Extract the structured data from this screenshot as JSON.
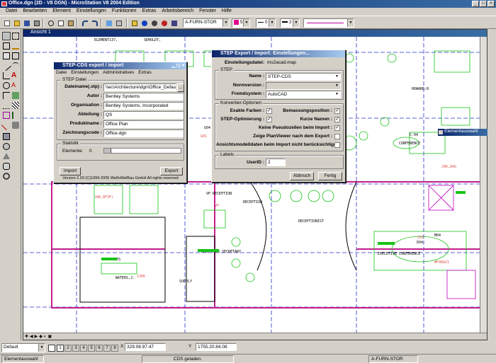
{
  "app": {
    "title": "Office.dgn (2D - V8 DGN) - MicroStation V8 2004 Edition",
    "menu": [
      "Datei",
      "Bearbeiten",
      "Element",
      "Einstellungen",
      "Funktionen",
      "Extras",
      "Arbeitsbereich",
      "Fenster",
      "Hilfe"
    ],
    "level_combo": "A-FURN-STOR",
    "color_value": "5",
    "style_value": "0",
    "weight_value": "2"
  },
  "view": {
    "title": "Ansicht 1"
  },
  "cad_labels": {
    "conference": "CONFERENCE",
    "reception": "RECEPTION",
    "receptionist": "RECEPTIONIST",
    "vp_reception": "VP RECEPTION",
    "waters": "WATERS,J.",
    "vice_pres_secretary": "VICE PRES SECRETARY",
    "executive_conference": "EXECUTIVE CONFERENCE",
    "vice_pres": "VICE PRES",
    "supply": "SUPPLY",
    "ceo": "C-04",
    "g04": "G04",
    "d04": "D04",
    "m04": "M04",
    "tag1": "ELEMENT137,",
    "tag2": "SEHOLDT,",
    "tag3": "HOWARD,R"
  },
  "step_export": {
    "title": "STEP-CDS export / import",
    "menu": [
      "Datei",
      "Einstellungen",
      "Administratives",
      "Extras"
    ],
    "group_label": "STEP Datei",
    "fields": [
      {
        "label": "Dateiname(.stp) :",
        "value": "\\\\ec\\Architecture\\dgn\\Office_Default.stp"
      },
      {
        "label": "Autor :",
        "value": "Bentley Systems"
      },
      {
        "label": "Organisation :",
        "value": "Bentley Systems, Incorporated"
      },
      {
        "label": "Abteilung :",
        "value": "QS"
      },
      {
        "label": "Produktname :",
        "value": "Office Plan"
      },
      {
        "label": "Zeichnungscode :",
        "value": "Office.dgn"
      }
    ],
    "stats_label": "Statistik",
    "elements_label": "Elemente:",
    "elements_value": "0",
    "import_button": "Import",
    "export_button": "Export",
    "version": "Version 2.03 (C)1999-2005 WelfoWelBau GmbH All rights reserved",
    "browse": "..."
  },
  "step_settings": {
    "title": "STEP Export / Import: Einstellungen...",
    "settings_file_label": "Einstellungsdatei:",
    "settings_file_value": "ms2acad.map",
    "step_group": "STEP",
    "name_label": "Name :",
    "name_value": "STEP-CDS",
    "version_label": "Normversion :",
    "version_value": "",
    "system_label": "Fremdsystem :",
    "system_value": "AutoCAD",
    "convert_group": "Konvertier-Optionen",
    "opt_exact_colors": "Exakte Farben :",
    "opt_step_opt": "STEP-Optimierung :",
    "opt_dim_pos": "Bemassungsposition :",
    "opt_short_names": "Kurze Namen :",
    "opt_no_pseudo": "Keine Pseudozellen beim Import :",
    "opt_planviewer": "Zeige PlanViewer nach dem Export :",
    "opt_view_data": "Ansichtsmodelldaten beim Import nicht berücksichtigen:",
    "labels_group": "Labels",
    "userid_label": "UserID :",
    "userid_value": "2",
    "cancel_button": "Abbruch",
    "ok_button": "Fertig"
  },
  "element_selection": {
    "title": "Elementauswahl"
  },
  "bottom": {
    "view_combo": "Default",
    "view_buttons": [
      "1",
      "2",
      "3",
      "4",
      "5",
      "6",
      "7",
      "8"
    ],
    "coord_x": "329.08.97.47",
    "coord_y": "1755.20.84.08"
  },
  "status": {
    "left": "Elementauswahl",
    "middle": "CDS geladen.",
    "right": "A-FURN-STOR"
  }
}
